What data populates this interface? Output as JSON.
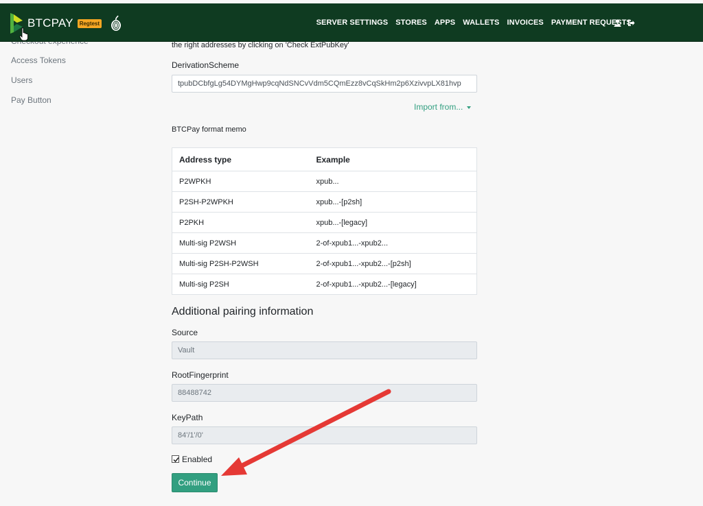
{
  "navbar": {
    "brand_text": "BTCPAY",
    "badge": "Regtest",
    "items": [
      "SERVER SETTINGS",
      "STORES",
      "APPS",
      "WALLETS",
      "INVOICES",
      "PAYMENT REQUESTS"
    ],
    "icons": [
      "user-icon",
      "sign-out-icon"
    ]
  },
  "sidebar": {
    "items": [
      "Checkout experience",
      "Access Tokens",
      "Users",
      "Pay Button"
    ]
  },
  "main": {
    "intro_text": "the right addresses by clicking on 'Check ExtPubKey'",
    "derivation_label": "DerivationScheme",
    "derivation_value": "tpubDCbfgLg54DYMgHwp9cqNdSNCvVdm5CQmEzz8vCqSkHm2p6XzivvpLX81hvp",
    "import_label": "Import from...",
    "memo_title": "BTCPay format memo",
    "table": {
      "headers": [
        "Address type",
        "Example"
      ],
      "rows": [
        [
          "P2WPKH",
          "xpub..."
        ],
        [
          "P2SH-P2WPKH",
          "xpub...-[p2sh]"
        ],
        [
          "P2PKH",
          "xpub...-[legacy]"
        ],
        [
          "Multi-sig P2WSH",
          "2-of-xpub1...-xpub2..."
        ],
        [
          "Multi-sig P2SH-P2WSH",
          "2-of-xpub1...-xpub2...-[p2sh]"
        ],
        [
          "Multi-sig P2SH",
          "2-of-xpub1...-xpub2...-[legacy]"
        ]
      ]
    },
    "pairing_title": "Additional pairing information",
    "source_label": "Source",
    "source_value": "Vault",
    "fingerprint_label": "RootFingerprint",
    "fingerprint_value": "88488742",
    "keypath_label": "KeyPath",
    "keypath_value": "84'/1'/0'",
    "enabled_label": "Enabled",
    "enabled_checked": true,
    "continue_label": "Continue"
  },
  "colors": {
    "navbar_bg": "#0f3b21",
    "accent": "#329f80",
    "badge": "#f5a623",
    "annotation_arrow": "#e53935"
  }
}
